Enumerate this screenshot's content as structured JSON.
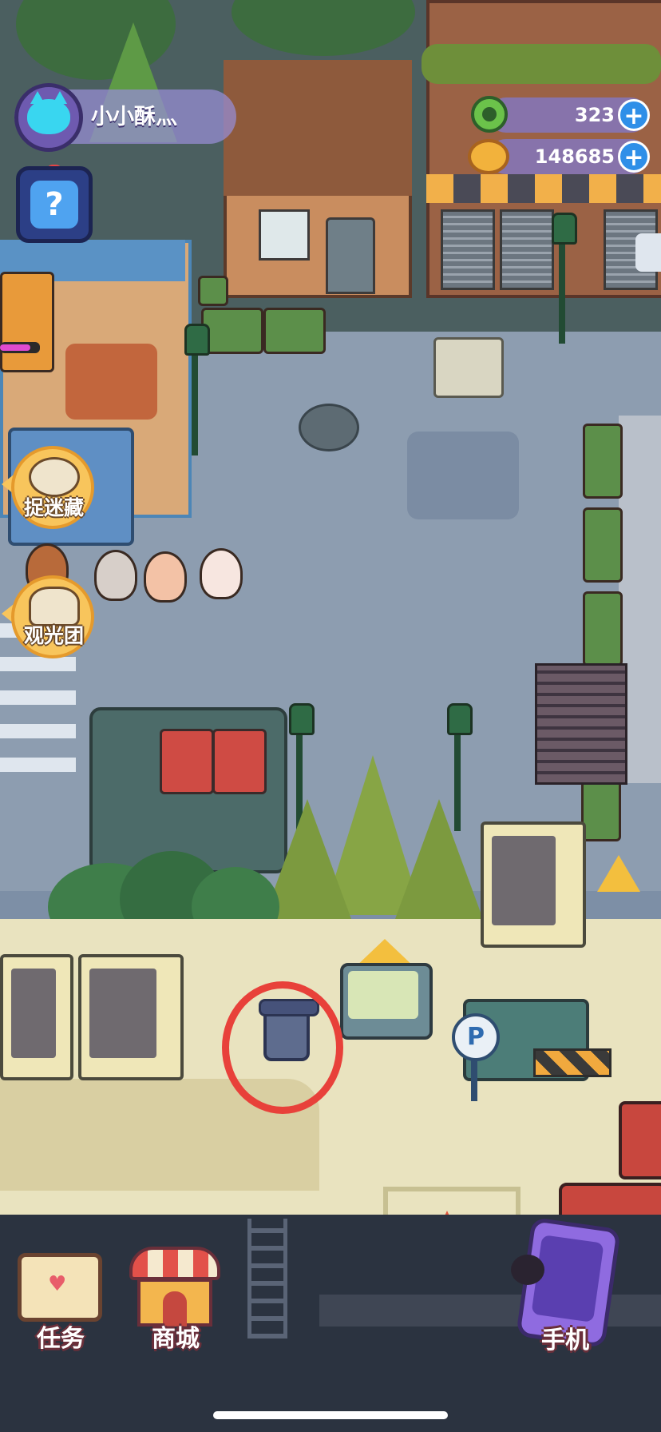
{
  "hud": {
    "player_name": "小小酥灬",
    "currencies": [
      {
        "icon": "green-gem-icon",
        "value": "323"
      },
      {
        "icon": "gold-coin-icon",
        "value": "148685"
      }
    ],
    "mystery_box_symbol": "?"
  },
  "side_buttons": [
    {
      "label": "捉迷藏",
      "icon": "hide-and-seek-icon"
    },
    {
      "label": "观光团",
      "icon": "tour-group-icon"
    }
  ],
  "bottom_bar": {
    "tasks_label": "任务",
    "shop_label": "商城",
    "phone_label": "手机"
  },
  "world": {
    "parking_sign": "P",
    "highlighted_object": "trash-can",
    "highlight_color": "#e8413a"
  },
  "colors": {
    "hud_pill": "#8c80d0",
    "plus_button": "#2f8fe8",
    "side_button": "#f8c55c"
  }
}
